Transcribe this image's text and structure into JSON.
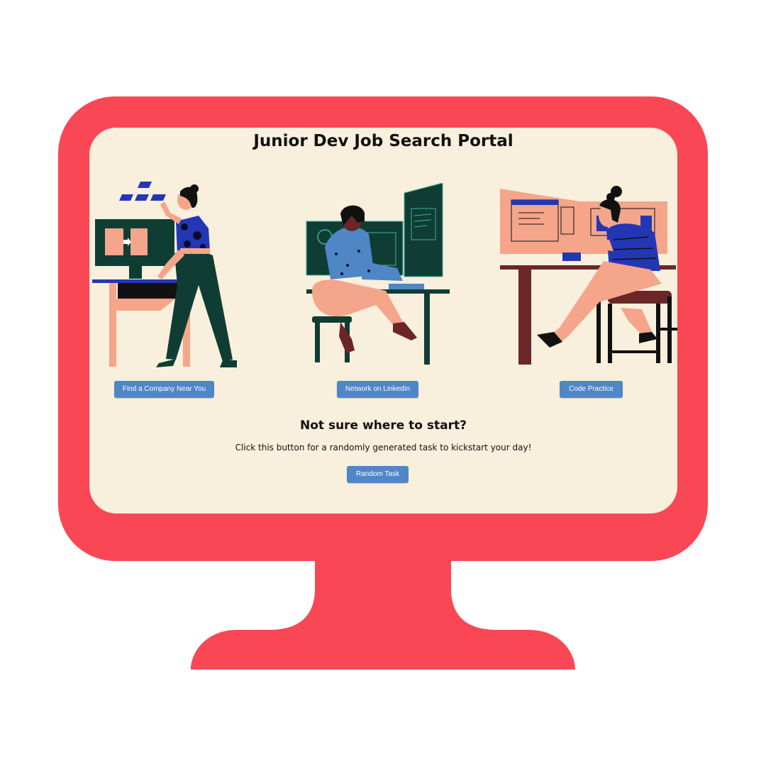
{
  "app": {
    "title": "Junior Dev Job Search Portal"
  },
  "actions": {
    "find_company": "Find a Company Near You",
    "network_linkedin": "Network on LinkedIn",
    "code_practice": "Code Practice"
  },
  "random": {
    "heading": "Not sure where to start?",
    "description": "Click this button for a randomly generated task to kickstart your day!",
    "button": "Random Task"
  },
  "colors": {
    "monitor": "#f94756",
    "screen_bg": "#f8efdc",
    "button": "#4f86c6",
    "dark_green": "#0f3d34",
    "salmon": "#f4a58a",
    "royal_blue": "#2337b5",
    "maroon": "#6b2626"
  },
  "illustrations": [
    {
      "icon": "person-standing-at-monitor-illustration"
    },
    {
      "icon": "person-typing-at-desk-illustration"
    },
    {
      "icon": "person-pointing-at-screens-illustration"
    }
  ]
}
